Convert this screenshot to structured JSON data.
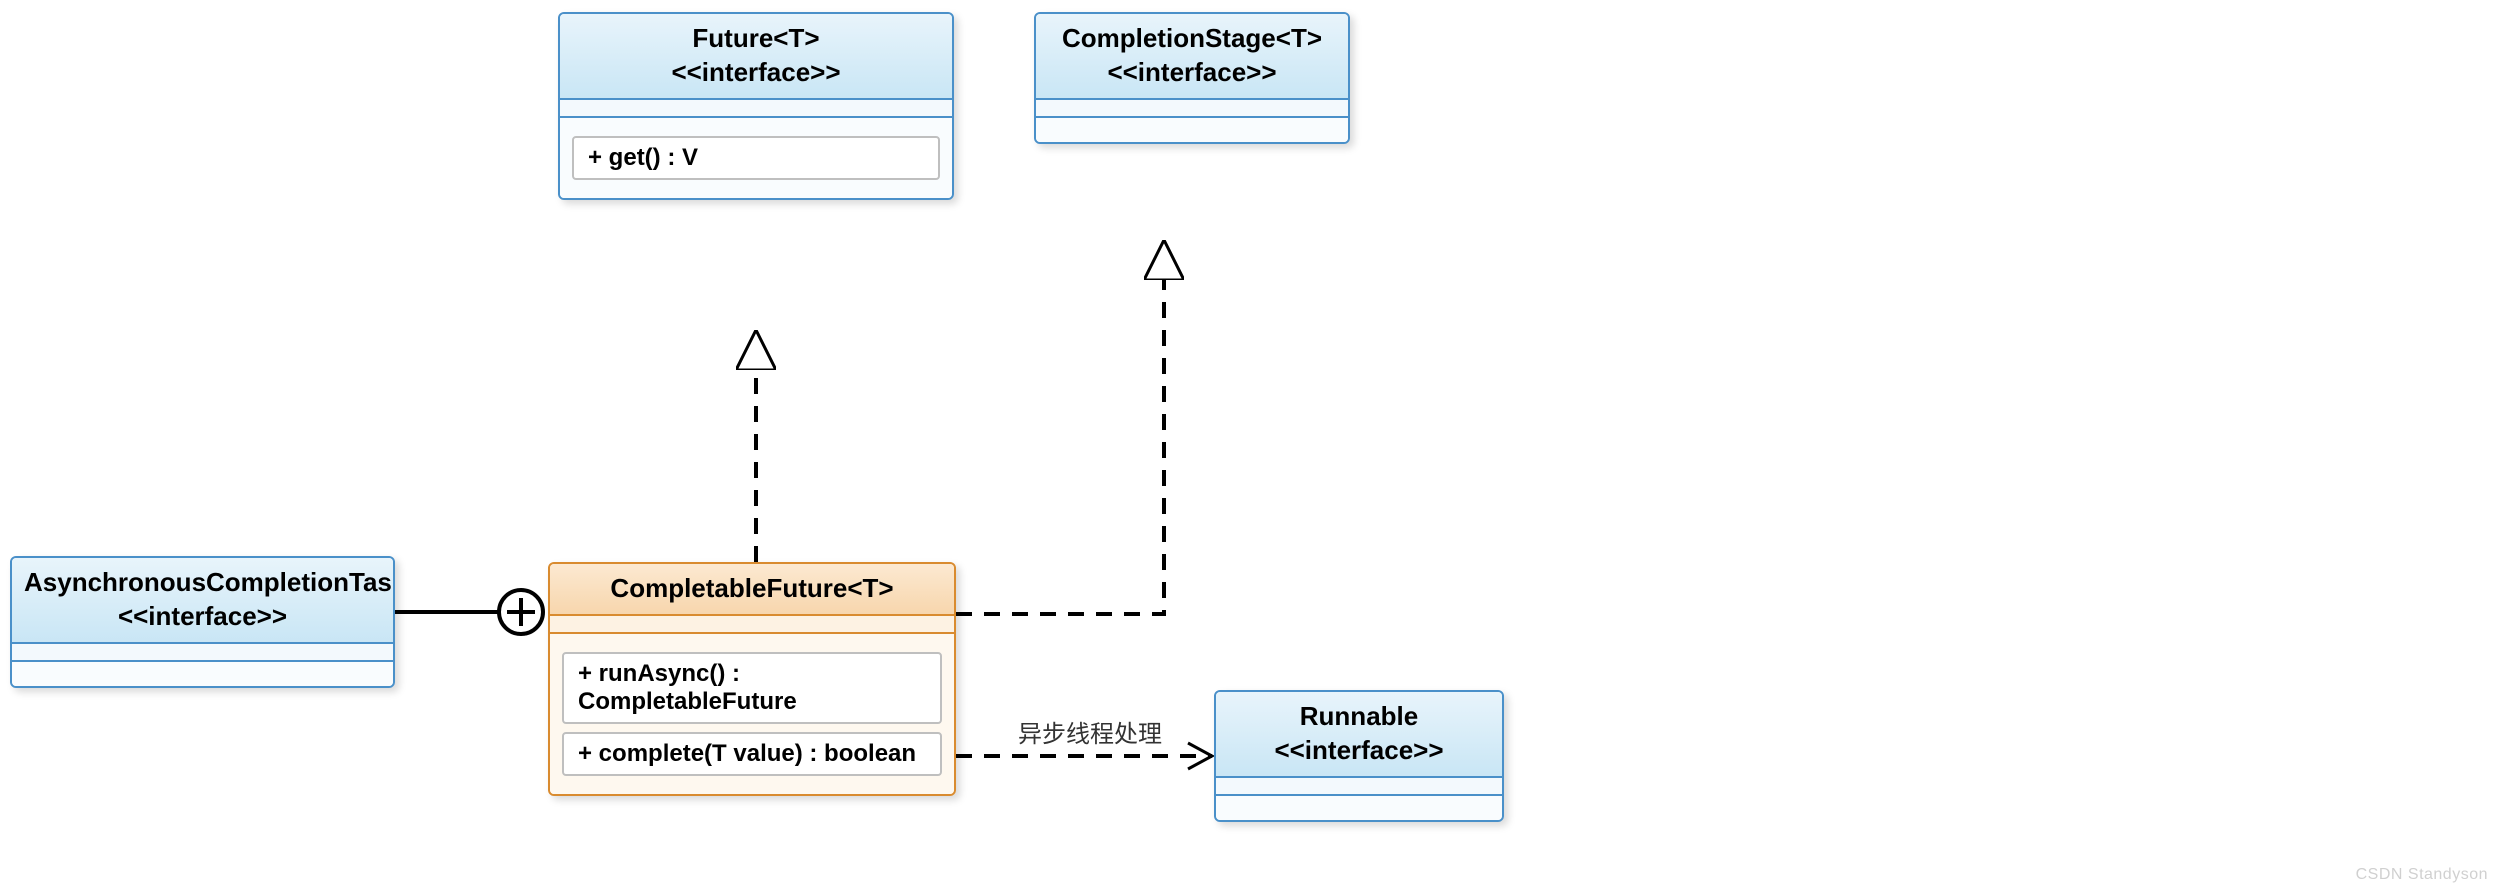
{
  "classes": {
    "future": {
      "name": "Future<T>",
      "stereotype": "<<interface>>",
      "ops": [
        "+ get() : V"
      ]
    },
    "completionStage": {
      "name": "CompletionStage<T>",
      "stereotype": "<<interface>>",
      "ops": []
    },
    "asyncTask": {
      "name": "AsynchronousCompletionTask",
      "stereotype": "<<interface>>",
      "ops": []
    },
    "completableFuture": {
      "name": "CompletableFuture<T>",
      "stereotype": "",
      "ops": [
        "+ runAsync() : CompletableFuture",
        "+ complete(T value) : boolean"
      ]
    },
    "runnable": {
      "name": "Runnable",
      "stereotype": "<<interface>>",
      "ops": []
    }
  },
  "edges": {
    "runnableLabel": "异步线程处理"
  },
  "chart_data": {
    "type": "diagram",
    "notation": "UML class diagram",
    "nodes": [
      {
        "id": "Future<T>",
        "stereotype": "interface",
        "operations": [
          "+ get() : V"
        ]
      },
      {
        "id": "CompletionStage<T>",
        "stereotype": "interface",
        "operations": []
      },
      {
        "id": "AsynchronousCompletionTask",
        "stereotype": "interface",
        "operations": []
      },
      {
        "id": "CompletableFuture<T>",
        "stereotype": "class",
        "operations": [
          "+ runAsync() : CompletableFuture",
          "+ complete(T value) : boolean"
        ]
      },
      {
        "id": "Runnable",
        "stereotype": "interface",
        "operations": []
      }
    ],
    "relationships": [
      {
        "from": "CompletableFuture<T>",
        "to": "Future<T>",
        "kind": "realization"
      },
      {
        "from": "CompletableFuture<T>",
        "to": "CompletionStage<T>",
        "kind": "realization"
      },
      {
        "from": "AsynchronousCompletionTask",
        "to": "CompletableFuture<T>",
        "kind": "nested/inner",
        "symbol": "circled-plus"
      },
      {
        "from": "CompletableFuture<T>",
        "to": "Runnable",
        "kind": "dependency",
        "label": "异步线程处理"
      }
    ]
  },
  "watermark": "CSDN Standyson"
}
